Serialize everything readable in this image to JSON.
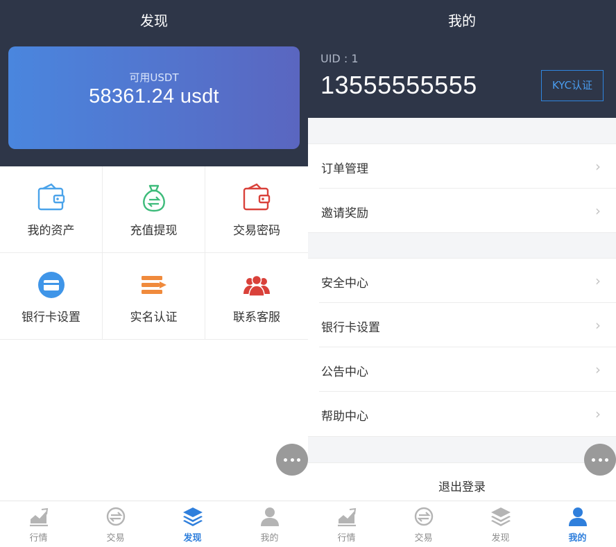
{
  "left": {
    "title": "发现",
    "balance": {
      "label": "可用USDT",
      "amount": "58361.24 usdt"
    },
    "grid": [
      {
        "label": "我的资产",
        "icon": "wallet-icon",
        "color": "#4aa3ea"
      },
      {
        "label": "充值提现",
        "icon": "money-bag-icon",
        "color": "#3dbb7a"
      },
      {
        "label": "交易密码",
        "icon": "wallet-lock-icon",
        "color": "#d9413a"
      },
      {
        "label": "银行卡设置",
        "icon": "bank-card-icon",
        "color": "#3f95e8"
      },
      {
        "label": "实名认证",
        "icon": "id-verify-icon",
        "color": "#f08a3c"
      },
      {
        "label": "联系客服",
        "icon": "customer-service-icon",
        "color": "#d9413a"
      }
    ],
    "tabs": [
      {
        "label": "行情",
        "icon": "chart-icon",
        "active": false
      },
      {
        "label": "交易",
        "icon": "exchange-icon",
        "active": false
      },
      {
        "label": "发现",
        "icon": "layers-icon",
        "active": true
      },
      {
        "label": "我的",
        "icon": "user-icon",
        "active": false
      }
    ]
  },
  "right": {
    "title": "我的",
    "uid_label": "UID : 1",
    "phone": "13555555555",
    "kyc_label": "KYC认证",
    "group1": [
      {
        "label": "订单管理"
      },
      {
        "label": "邀请奖励"
      }
    ],
    "group2": [
      {
        "label": "安全中心"
      },
      {
        "label": "银行卡设置"
      },
      {
        "label": "公告中心"
      },
      {
        "label": "帮助中心"
      }
    ],
    "logout_label": "退出登录",
    "tabs": [
      {
        "label": "行情",
        "icon": "chart-icon",
        "active": false
      },
      {
        "label": "交易",
        "icon": "exchange-icon",
        "active": false
      },
      {
        "label": "发现",
        "icon": "layers-icon",
        "active": false
      },
      {
        "label": "我的",
        "icon": "user-icon",
        "active": true
      }
    ]
  },
  "colors": {
    "header_bg": "#2e3648",
    "accent": "#2f7fdc",
    "inactive": "#8d8d8d"
  }
}
